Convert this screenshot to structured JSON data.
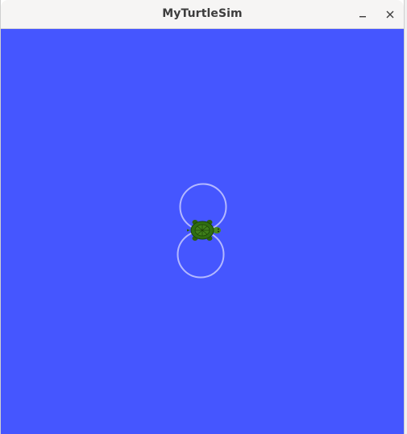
{
  "window": {
    "title": "MyTurtleSim"
  },
  "titlebar_buttons": {
    "minimize_icon": "minimize-icon",
    "close_icon": "close-icon"
  },
  "canvas": {
    "background_color": "#4556ff",
    "trail_color": "#b3b8ff",
    "turtle": {
      "icon": "turtle-icon",
      "shell_color": "#2f6e12",
      "body_color": "#4a8a1e"
    }
  }
}
